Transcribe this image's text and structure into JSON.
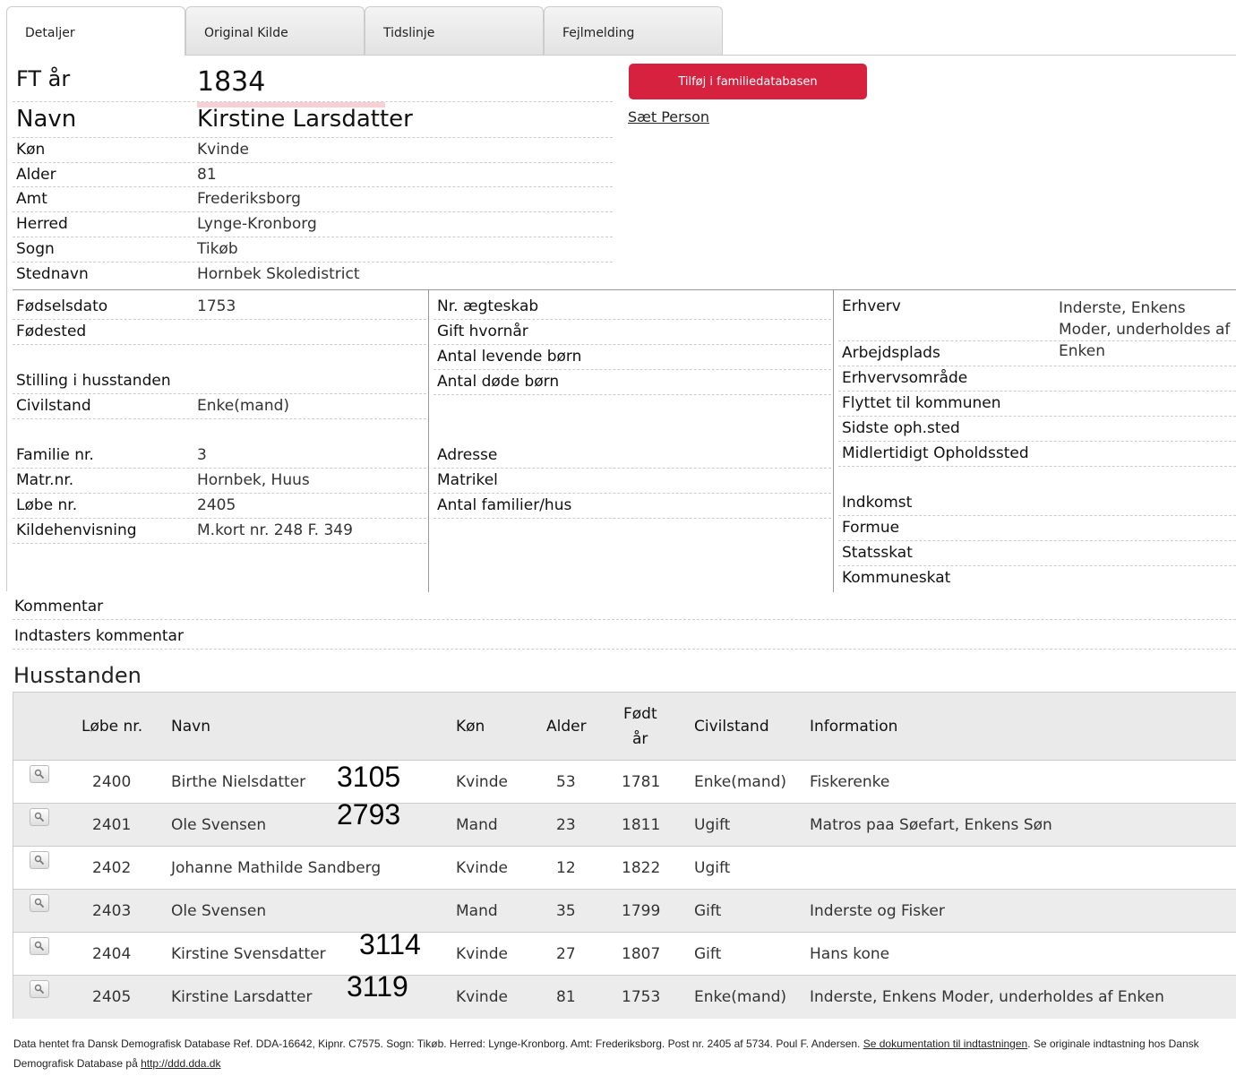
{
  "tabs": [
    "Detaljer",
    "Original Kilde",
    "Tidslinje",
    "Fejlmelding"
  ],
  "header": {
    "ft_label": "FT år",
    "ft_value": "1834",
    "name_label": "Navn",
    "name_value": "Kirstine Larsdatter"
  },
  "actions": {
    "add_button": "Tilføj i familiedatabasen",
    "set_person": "Sæt Person"
  },
  "details": [
    {
      "label": "Køn",
      "value": "Kvinde"
    },
    {
      "label": "Alder",
      "value": "81"
    },
    {
      "label": "Amt",
      "value": "Frederiksborg"
    },
    {
      "label": "Herred",
      "value": "Lynge-Kronborg"
    },
    {
      "label": "Sogn",
      "value": "Tikøb"
    },
    {
      "label": "Stednavn",
      "value": "Hornbek Skoledistrict"
    }
  ],
  "col1": {
    "fodselsdato_label": "Fødselsdato",
    "fodselsdato": "1753",
    "fodested_label": "Fødested",
    "stilling_label": "Stilling i husstanden",
    "civilstand_label": "Civilstand",
    "civilstand": "Enke(mand)",
    "familie_label": "Familie nr.",
    "familie": "3",
    "matr_label": "Matr.nr.",
    "matr": "Hornbek, Huus",
    "lobe_label": "Løbe nr.",
    "lobe": "2405",
    "kilde_label": "Kildehenvisning",
    "kilde": "M.kort nr. 248 F. 349"
  },
  "col2": {
    "aegteskab": "Nr. ægteskab",
    "gift": "Gift hvornår",
    "levende": "Antal levende børn",
    "dode": "Antal døde børn",
    "adresse": "Adresse",
    "matrikel": "Matrikel",
    "familier": "Antal familier/hus"
  },
  "col3": {
    "erhverv_label": "Erhverv",
    "erhverv": "Inderste, Enkens Moder, underholdes af Enken",
    "arbejdsplads": "Arbejdsplads",
    "erhvervsomrade": "Erhvervsområde",
    "flyttet": "Flyttet til kommunen",
    "sidste": "Sidste oph.sted",
    "midlertidigt": "Midlertidigt Opholdssted",
    "indkomst": "Indkomst",
    "formue": "Formue",
    "statsskat": "Statsskat",
    "kommuneskat": "Kommuneskat"
  },
  "comments": {
    "kommentar": "Kommentar",
    "indtaster": "Indtasters kommentar"
  },
  "household": {
    "title": "Husstanden",
    "headers": {
      "lobe": "Løbe nr.",
      "navn": "Navn",
      "kon": "Køn",
      "alder": "Alder",
      "fodt1": "Født",
      "fodt2": "år",
      "civil": "Civilstand",
      "info": "Information"
    },
    "rows": [
      {
        "lobe": "2400",
        "navn": "Birthe Nielsdatter",
        "kon": "Kvinde",
        "alder": "53",
        "fodt": "1781",
        "civil": "Enke(mand)",
        "info": "Fiskerenke"
      },
      {
        "lobe": "2401",
        "navn": "Ole Svensen",
        "kon": "Mand",
        "alder": "23",
        "fodt": "1811",
        "civil": "Ugift",
        "info": "Matros paa Søefart, Enkens Søn"
      },
      {
        "lobe": "2402",
        "navn": "Johanne Mathilde Sandberg",
        "kon": "Kvinde",
        "alder": "12",
        "fodt": "1822",
        "civil": "Ugift",
        "info": ""
      },
      {
        "lobe": "2403",
        "navn": "Ole Svensen",
        "kon": "Mand",
        "alder": "35",
        "fodt": "1799",
        "civil": "Gift",
        "info": "Inderste og Fisker"
      },
      {
        "lobe": "2404",
        "navn": "Kirstine Svensdatter",
        "kon": "Kvinde",
        "alder": "27",
        "fodt": "1807",
        "civil": "Gift",
        "info": "Hans kone"
      },
      {
        "lobe": "2405",
        "navn": "Kirstine Larsdatter",
        "kon": "Kvinde",
        "alder": "81",
        "fodt": "1753",
        "civil": "Enke(mand)",
        "info": "Inderste, Enkens Moder, underholdes af Enken"
      }
    ],
    "annotations": [
      "3105",
      "2793",
      "3114",
      "3119"
    ]
  },
  "footer": {
    "text1": "Data hentet fra Dansk Demografisk Database Ref. DDA-16642, Kipnr. C7575. Sogn: Tikøb. Herred: Lynge-Kronborg. Amt: Frederiksborg. Post nr. 2405 af 5734. Poul F. Andersen. ",
    "link1": "Se dokumentation til indtastningen",
    "text2": ". Se originale indtastning hos Dansk Demografisk Database på ",
    "link2": "http://ddd.dda.dk"
  }
}
